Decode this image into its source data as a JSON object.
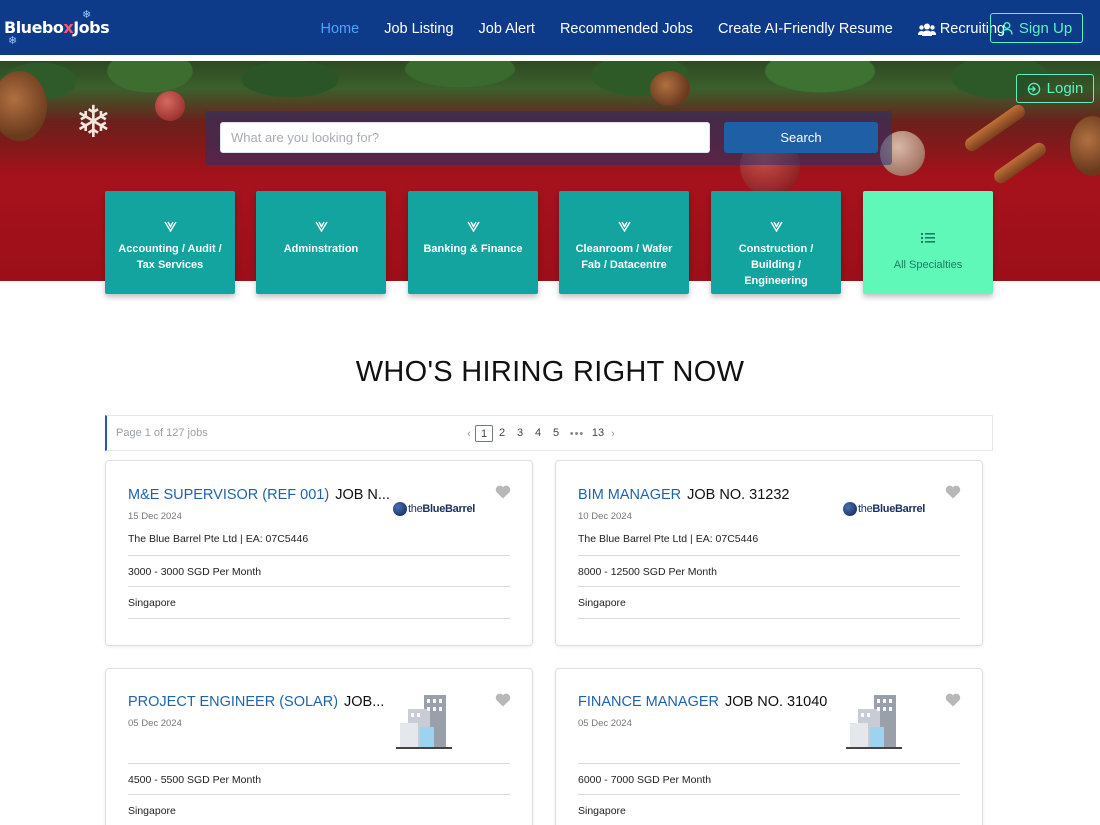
{
  "brand": {
    "logo_text_a": "Bluebo",
    "logo_text_b": "x",
    "logo_text_c": "Jobs"
  },
  "nav": {
    "links": [
      {
        "label": "Home",
        "active": true
      },
      {
        "label": "Job Listing"
      },
      {
        "label": "Job Alert"
      },
      {
        "label": "Recommended Jobs"
      },
      {
        "label": "Create AI-Friendly Resume"
      },
      {
        "label": "Recruiting",
        "icon": "users-icon"
      }
    ],
    "signup_label": "Sign Up",
    "login_label": "Login"
  },
  "search": {
    "placeholder": "What are you looking for?",
    "button_label": "Search"
  },
  "categories": [
    {
      "label": "Accounting / Audit / Tax Services",
      "icon": "chevron-v-icon"
    },
    {
      "label": "Adminstration",
      "icon": "chevron-v-icon"
    },
    {
      "label": "Banking & Finance",
      "icon": "chevron-v-icon"
    },
    {
      "label": "Cleanroom / Wafer Fab / Datacentre",
      "icon": "chevron-v-icon"
    },
    {
      "label": "Construction / Building / Engineering",
      "icon": "chevron-v-icon"
    },
    {
      "label": "All Specialties",
      "icon": "list-icon"
    }
  ],
  "colors": {
    "nav_bg": "#0d3b8a",
    "tile": "#13a4a0",
    "tile_all": "#5ff8b8",
    "accent_green": "#5cf2c0",
    "link_blue": "#1f63ad"
  },
  "section": {
    "title": "WHO'S HIRING RIGHT NOW"
  },
  "pager": {
    "info": "Page 1 of 127 jobs",
    "pages": [
      "1",
      "2",
      "3",
      "4",
      "5"
    ],
    "ellipsis": "•••",
    "last": "13",
    "current": "1"
  },
  "jobs": [
    {
      "role": "M&E SUPERVISOR (REF 001)",
      "jobno": "JOB N...",
      "date": "15 Dec 2024",
      "company": "The Blue Barrel Pte Ltd | EA: 07C5446",
      "salary": "3000 - 3000 SGD Per Month",
      "location": "Singapore",
      "logo": "bluebarrel"
    },
    {
      "role": "BIM MANAGER",
      "jobno": "JOB NO. 31232",
      "date": "10 Dec 2024",
      "company": "The Blue Barrel Pte Ltd | EA: 07C5446",
      "salary": "8000 - 12500 SGD Per Month",
      "location": "Singapore",
      "logo": "bluebarrel"
    },
    {
      "role": "PROJECT ENGINEER (SOLAR)",
      "jobno": "JOB...",
      "date": "05 Dec 2024",
      "company": "",
      "salary": "4500 - 5500 SGD Per Month",
      "location": "Singapore",
      "logo": "building"
    },
    {
      "role": "FINANCE MANAGER",
      "jobno": "JOB NO. 31040",
      "date": "05 Dec 2024",
      "company": "",
      "salary": "6000 - 7000 SGD Per Month",
      "location": "Singapore",
      "logo": "building"
    }
  ],
  "logos": {
    "bluebarrel_a": "the",
    "bluebarrel_b": "BlueBarrel"
  }
}
